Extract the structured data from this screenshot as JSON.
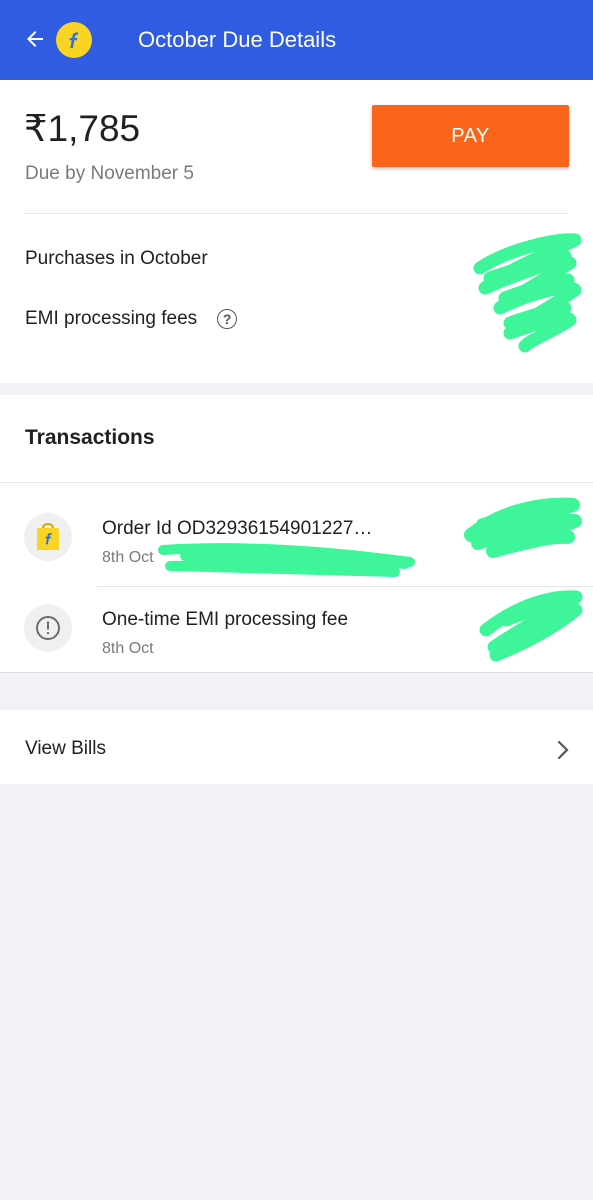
{
  "header": {
    "title": "October Due Details",
    "back_icon": "arrow-left-icon",
    "logo_icon": "flipkart-logo"
  },
  "summary": {
    "amount": "₹1,785",
    "due_by": "Due by November 5",
    "pay_label": "PAY",
    "rows": {
      "purchases_label": "Purchases in October",
      "emi_fees_label": "EMI processing fees"
    },
    "help_icon": "question-circle-icon"
  },
  "transactions": {
    "title": "Transactions",
    "items": [
      {
        "title": "Order Id OD32936154901227…",
        "date": "8th Oct",
        "icon": "flipkart-bag-icon"
      },
      {
        "title": "One-time EMI processing fee",
        "date": "8th Oct",
        "icon": "exclamation-circle-icon"
      }
    ]
  },
  "view_bills": {
    "label": "View Bills",
    "icon": "chevron-right-icon"
  },
  "colors": {
    "header_bg": "#2f5ce0",
    "pay_button": "#fb641b",
    "page_bg": "#f1f2f6",
    "redaction": "#3ef59a"
  }
}
